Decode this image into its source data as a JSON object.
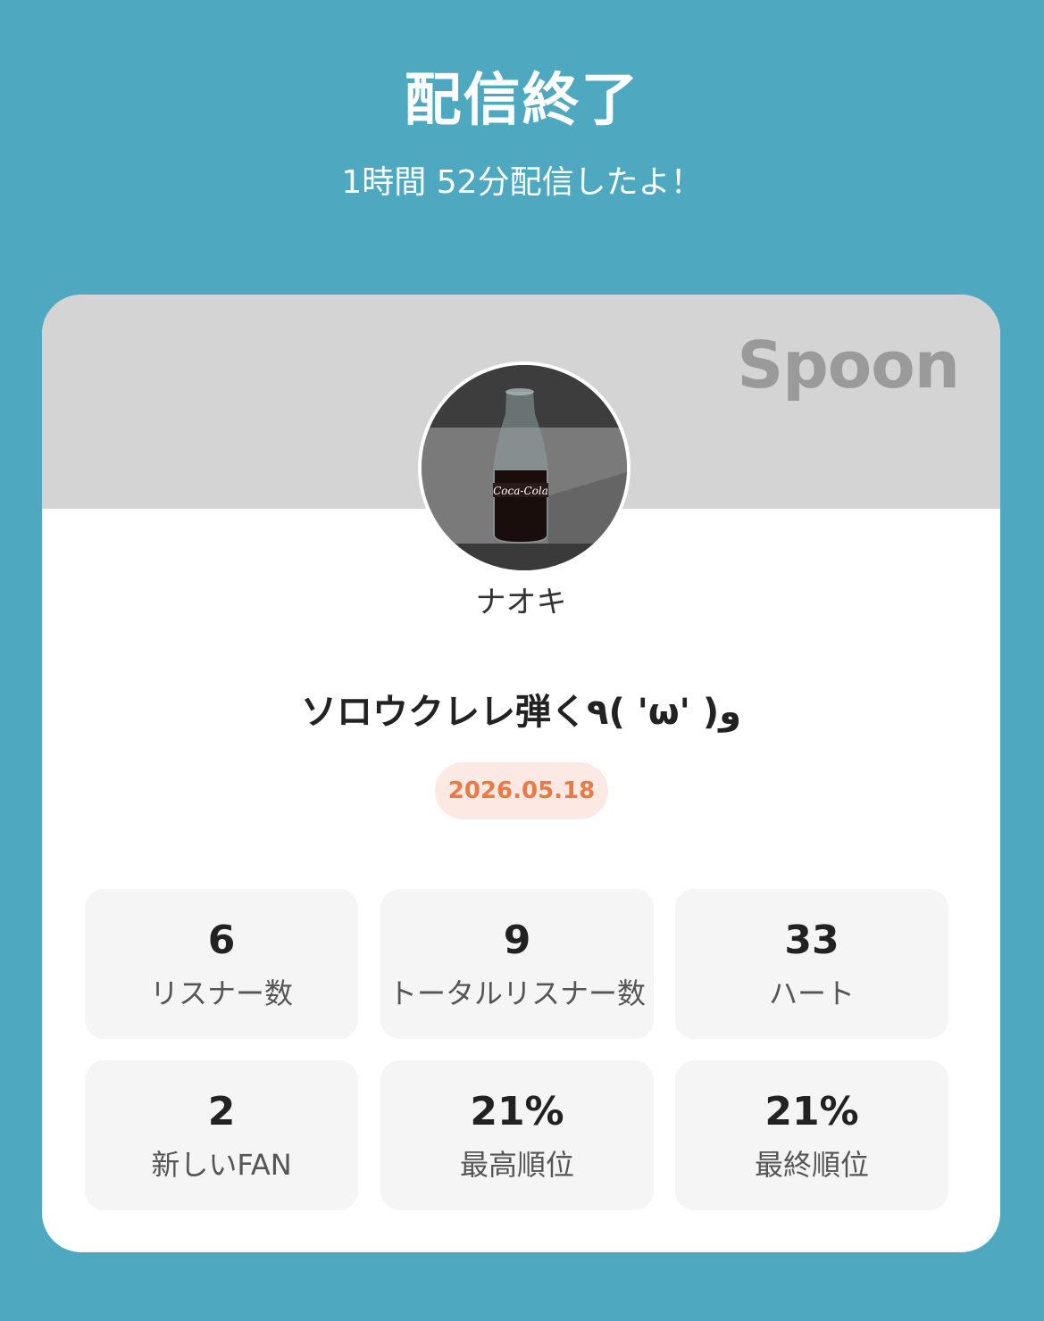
{
  "header": {
    "title": "配信終了",
    "subtitle": "1時間 52分配信したよ！"
  },
  "card": {
    "brand": "Spoon",
    "username": "ナオキ",
    "room_title": "ソロウクレレ弾く٩( 'ω' )و",
    "date": "2026.05.18",
    "date_color": "#e97a47",
    "avatar_icon": "profile-photo-cola-bottle",
    "stats": [
      {
        "value": "6",
        "label": "リスナー数"
      },
      {
        "value": "9",
        "label": "トータルリスナー数"
      },
      {
        "value": "33",
        "label": "ハート"
      },
      {
        "value": "2",
        "label": "新しいFAN"
      },
      {
        "value": "21%",
        "label": "最高順位"
      },
      {
        "value": "21%",
        "label": "最終順位"
      }
    ]
  },
  "colors": {
    "background": "#4ea8c0",
    "card": "#ffffff",
    "card_header": "#d4d4d4",
    "tile": "#f5f5f5",
    "badge_bg": "#fce9e3"
  }
}
